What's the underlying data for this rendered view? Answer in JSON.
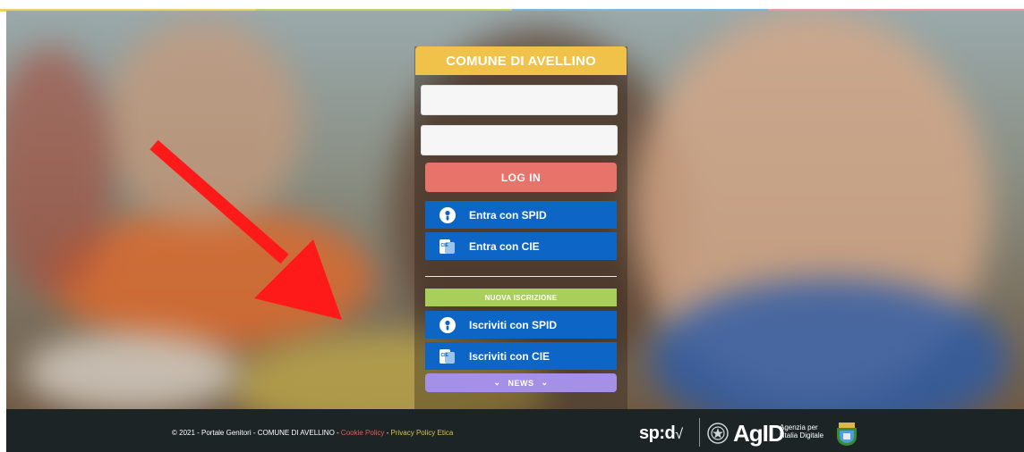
{
  "accent_colors": {
    "brand": "#f0c24a",
    "login": "#e8736b",
    "spid_blue": "#0d66c6",
    "new_green": "#a9cf5b",
    "news_purple": "#a590e8",
    "footer_bg": "#1c2426",
    "arrow_red": "#ff1a1a"
  },
  "panel": {
    "brand_title": "COMUNE DI AVELLINO",
    "username": {
      "value": "",
      "placeholder": ""
    },
    "password": {
      "value": "",
      "placeholder": ""
    },
    "login_label": "LOG IN",
    "spid_login": {
      "label": "Entra con SPID",
      "icon": "spid-user-icon"
    },
    "cie_login": {
      "label": "Entra con CIE",
      "icon": "cie-card-icon"
    },
    "new_registration_label": "NUOVA ISCRIZIONE",
    "spid_register": {
      "label": "Iscriviti con SPID",
      "icon": "spid-user-icon"
    },
    "cie_register": {
      "label": "Iscriviti con CIE",
      "icon": "cie-card-icon"
    },
    "news_label": "NEWS",
    "news_icon": "chevron-down-icon"
  },
  "footer": {
    "copyright": "© 2021 - Portale Genitori - COMUNE DI AVELLINO - ",
    "cookie_link": "Cookie Policy",
    "separator": " - ",
    "privacy_link": "Privacy Policy Etica",
    "spid_logo": "sp:d",
    "agid_logo": "AgID",
    "agid_sub_1": "Agenzia per",
    "agid_sub_2": "l'Italia Digitale"
  }
}
